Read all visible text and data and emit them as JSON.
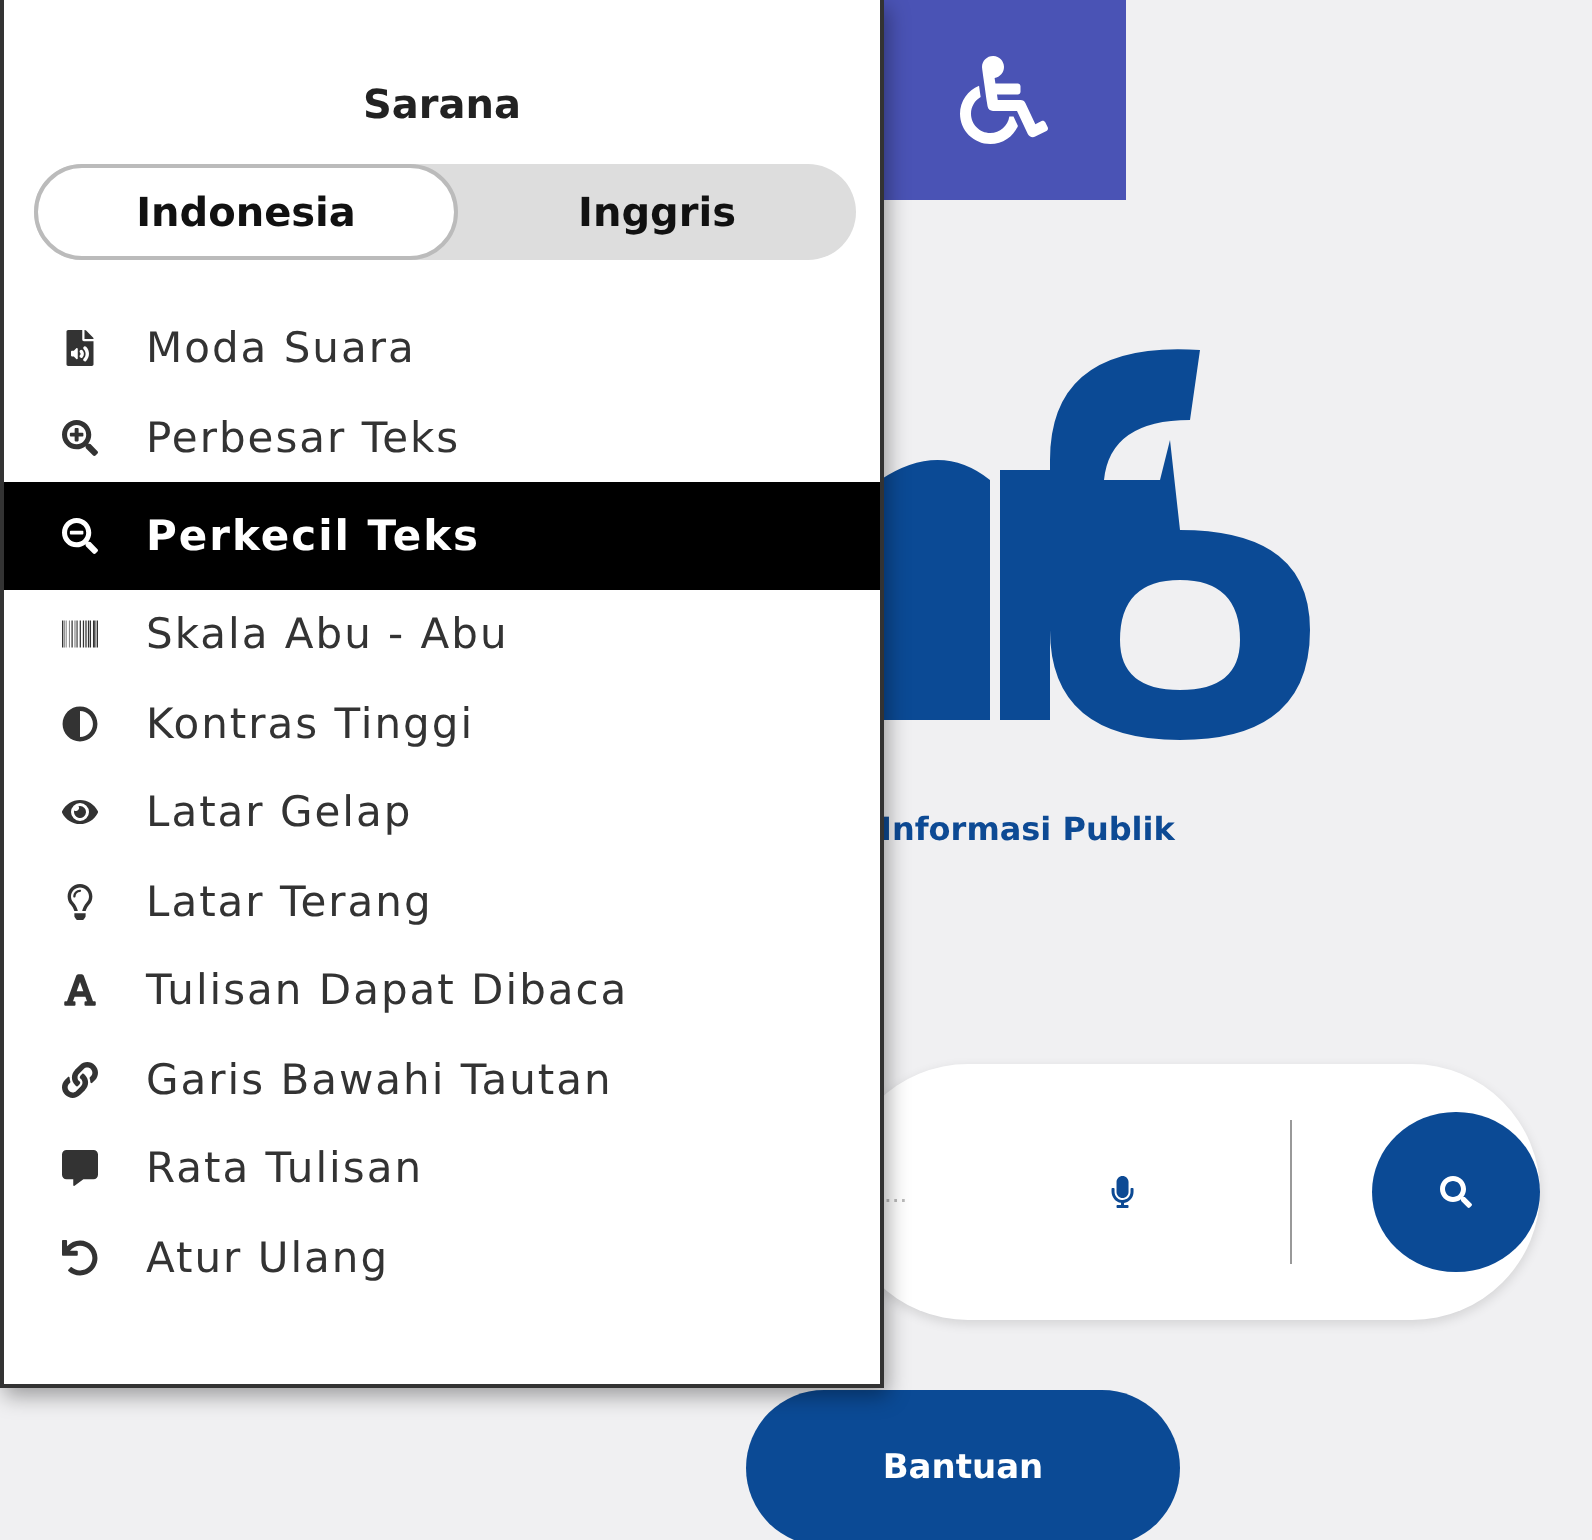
{
  "panel": {
    "title": "Sarana",
    "languages": [
      {
        "label": "Indonesia",
        "selected": true
      },
      {
        "label": "Inggris",
        "selected": false
      }
    ],
    "items": [
      {
        "label": "Moda Suara",
        "selected": false
      },
      {
        "label": "Perbesar Teks",
        "selected": false
      },
      {
        "label": "Perkecil Teks",
        "selected": true
      },
      {
        "label": "Skala Abu - Abu",
        "selected": false
      },
      {
        "label": "Kontras Tinggi",
        "selected": false
      },
      {
        "label": "Latar Gelap",
        "selected": false
      },
      {
        "label": "Latar Terang",
        "selected": false
      },
      {
        "label": "Tulisan Dapat Dibaca",
        "selected": false
      },
      {
        "label": "Garis Bawahi Tautan",
        "selected": false
      },
      {
        "label": "Rata Tulisan",
        "selected": false
      },
      {
        "label": "Atur Ulang",
        "selected": false
      }
    ]
  },
  "page": {
    "tagline": "Informasi Publik",
    "search": {
      "placeholder": "..."
    },
    "help_button": "Bantuan"
  }
}
